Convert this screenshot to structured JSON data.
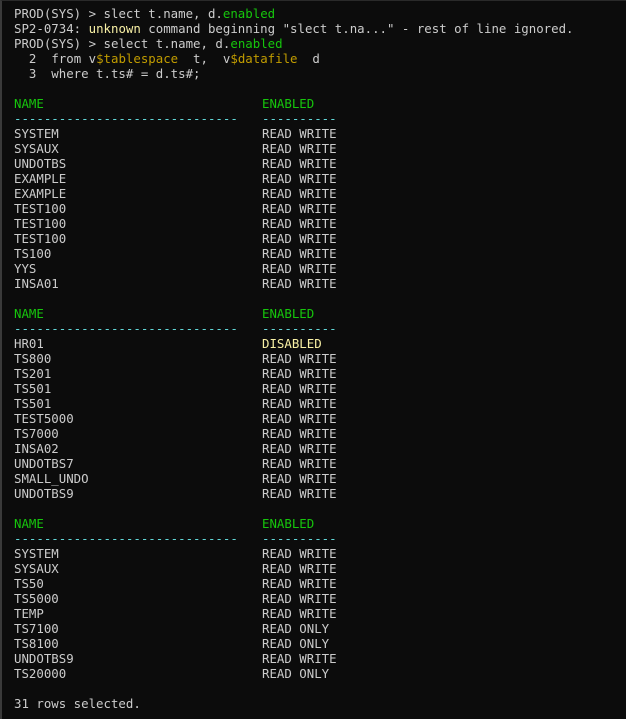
{
  "terminal": {
    "colors": {
      "background": "#0c0c0c",
      "foreground": "#cccccc",
      "keyword": "#16c60c",
      "warning_word": "#f9f1a5",
      "header": "#16c60c",
      "separator": "#61d6d6",
      "disabled": "#f9f1a5"
    },
    "command1": {
      "prompt": "PROD(SYS) > ",
      "text": "slect t.name, d.",
      "keyword": "enabled"
    },
    "error": {
      "code": "SP2-0734: ",
      "highlight": "unknown",
      "rest": " command beginning \"slect t.na...\" - rest of line ignored."
    },
    "command2": {
      "prompt": "PROD(SYS) > ",
      "text": "select t.name, d.",
      "keyword": "enabled"
    },
    "sql_line2": {
      "num": "  2  ",
      "pre": "from v",
      "view1": "$tablespace",
      "mid": "  t,  v",
      "view2": "$datafile",
      "post": "  d"
    },
    "sql_line3": "  3  where t.ts# = d.ts#;",
    "header": {
      "name": "NAME",
      "enabled": "ENABLED",
      "sep_name": "------------------------------",
      "sep_enabled": "----------"
    },
    "groups": [
      {
        "rows": [
          {
            "name": "SYSTEM",
            "enabled": "READ WRITE"
          },
          {
            "name": "SYSAUX",
            "enabled": "READ WRITE"
          },
          {
            "name": "UNDOTBS",
            "enabled": "READ WRITE"
          },
          {
            "name": "EXAMPLE",
            "enabled": "READ WRITE"
          },
          {
            "name": "EXAMPLE",
            "enabled": "READ WRITE"
          },
          {
            "name": "TEST100",
            "enabled": "READ WRITE"
          },
          {
            "name": "TEST100",
            "enabled": "READ WRITE"
          },
          {
            "name": "TEST100",
            "enabled": "READ WRITE"
          },
          {
            "name": "TS100",
            "enabled": "READ WRITE"
          },
          {
            "name": "YYS",
            "enabled": "READ WRITE"
          },
          {
            "name": "INSA01",
            "enabled": "READ WRITE"
          }
        ]
      },
      {
        "rows": [
          {
            "name": "HR01",
            "enabled": "DISABLED"
          },
          {
            "name": "TS800",
            "enabled": "READ WRITE"
          },
          {
            "name": "TS201",
            "enabled": "READ WRITE"
          },
          {
            "name": "TS501",
            "enabled": "READ WRITE"
          },
          {
            "name": "TS501",
            "enabled": "READ WRITE"
          },
          {
            "name": "TEST5000",
            "enabled": "READ WRITE"
          },
          {
            "name": "TS7000",
            "enabled": "READ WRITE"
          },
          {
            "name": "INSA02",
            "enabled": "READ WRITE"
          },
          {
            "name": "UNDOTBS7",
            "enabled": "READ WRITE"
          },
          {
            "name": "SMALL_UNDO",
            "enabled": "READ WRITE"
          },
          {
            "name": "UNDOTBS9",
            "enabled": "READ WRITE"
          }
        ]
      },
      {
        "rows": [
          {
            "name": "SYSTEM",
            "enabled": "READ WRITE"
          },
          {
            "name": "SYSAUX",
            "enabled": "READ WRITE"
          },
          {
            "name": "TS50",
            "enabled": "READ WRITE"
          },
          {
            "name": "TS5000",
            "enabled": "READ WRITE"
          },
          {
            "name": "TEMP",
            "enabled": "READ WRITE"
          },
          {
            "name": "TS7100",
            "enabled": "READ ONLY"
          },
          {
            "name": "TS8100",
            "enabled": "READ ONLY"
          },
          {
            "name": "UNDOTBS9",
            "enabled": "READ WRITE"
          },
          {
            "name": "TS20000",
            "enabled": "READ ONLY"
          }
        ]
      }
    ],
    "footer": "31 rows selected."
  }
}
